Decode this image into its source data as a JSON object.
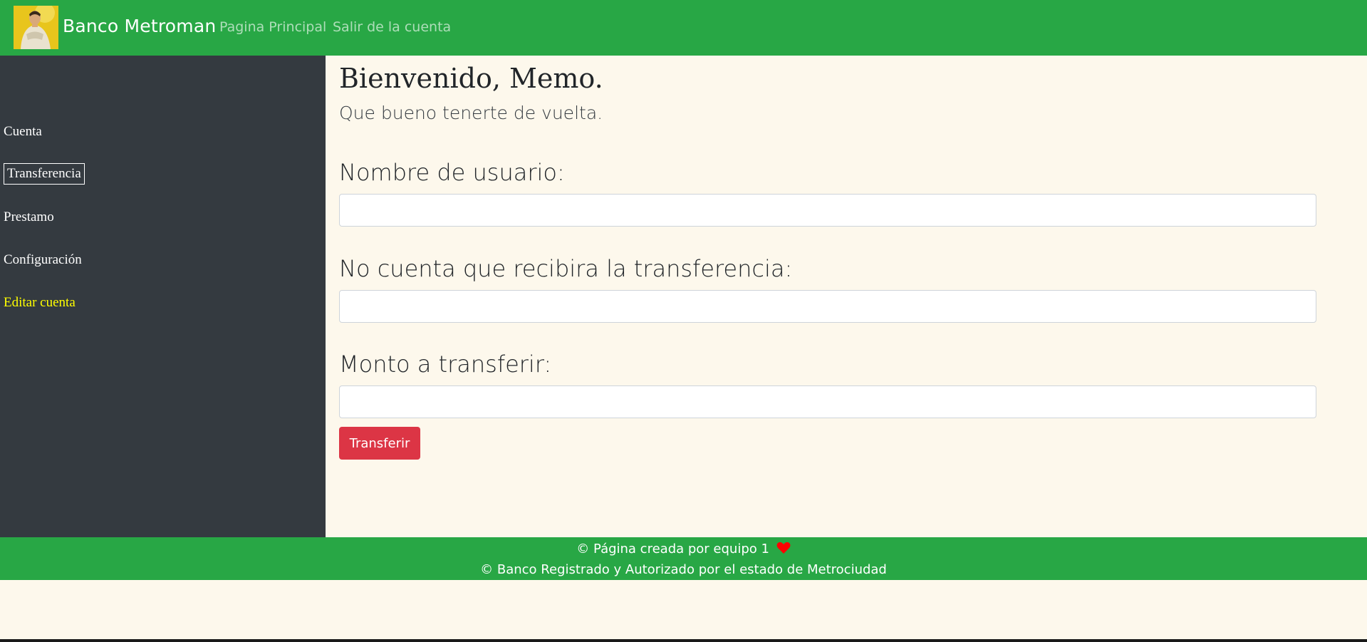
{
  "navbar": {
    "brand": "Banco Metroman",
    "links": [
      "Pagina Principal",
      "Salir de la cuenta"
    ],
    "logo_icon": "metroman-avatar-icon",
    "color": "#28a745"
  },
  "sidebar": {
    "items": [
      "Cuenta",
      "Transferencia",
      "Prestamo",
      "Configuración",
      "Editar cuenta"
    ],
    "active": "Transferencia",
    "color": "#343a40",
    "highlight_color": "#ffff00"
  },
  "main": {
    "welcome": "Bienvenido, Memo.",
    "subtitle": "Que bueno tenerte de vuelta.",
    "fields": [
      {
        "label": "Nombre de usuario:",
        "value": ""
      },
      {
        "label": "No cuenta que recibira la transferencia:",
        "value": ""
      },
      {
        "label": "Monto a transferir:",
        "value": ""
      }
    ],
    "submit_label": "Transferir",
    "submit_color": "#dc3545"
  },
  "footer": {
    "line1": "© Página creada por equipo 1",
    "line2": "© Banco Registrado y Autorizado por el estado de Metrociudad",
    "heart_icon": "heart-icon",
    "heart_color": "#ff0000"
  }
}
